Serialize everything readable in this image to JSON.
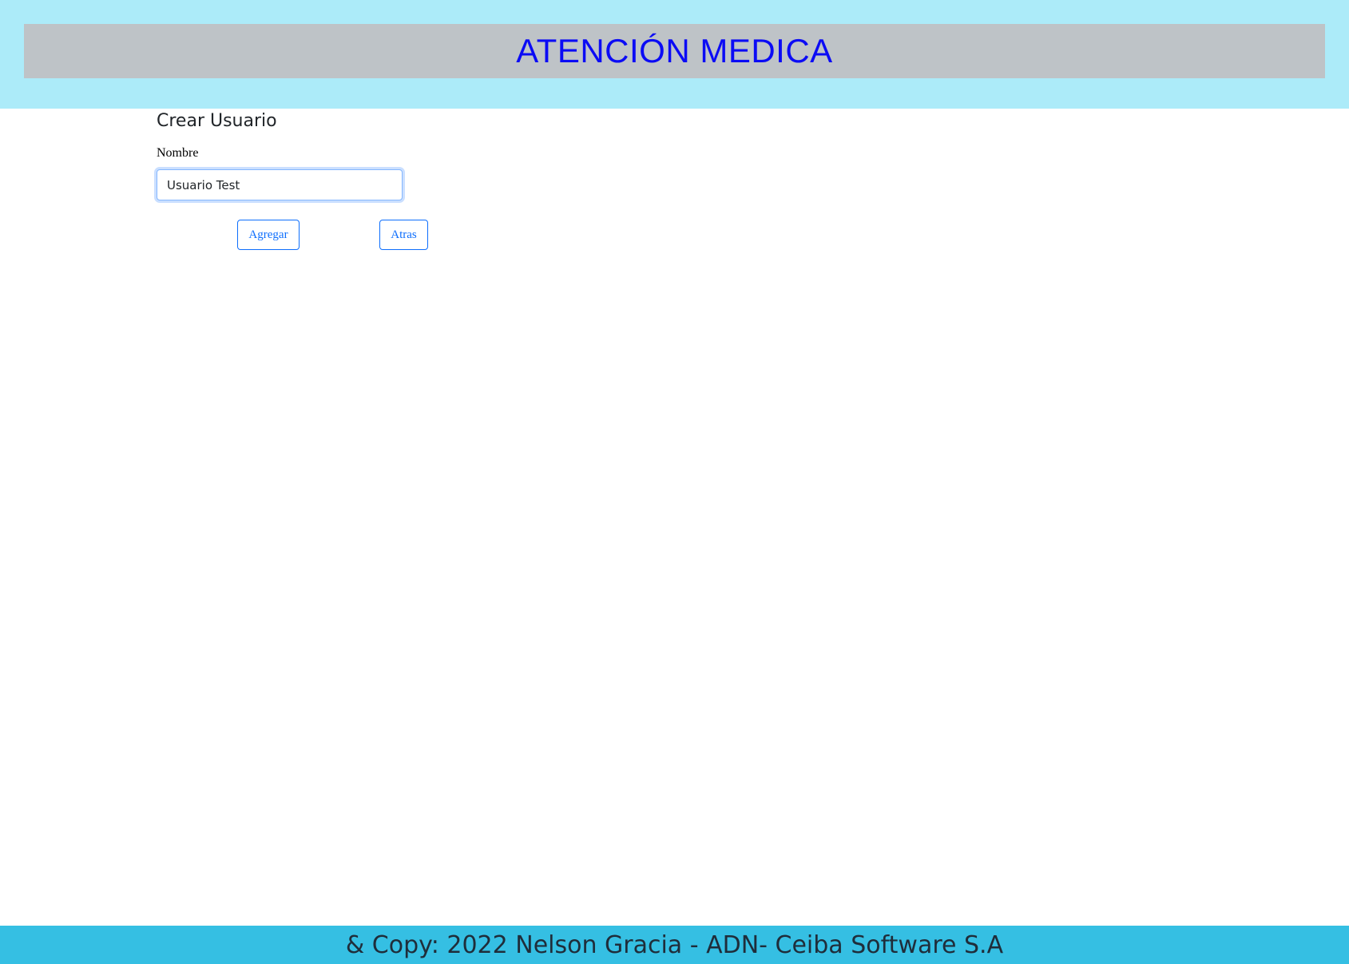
{
  "header": {
    "title": "ATENCIÓN MEDICA",
    "background_color": "#acebf9",
    "title_bar_color": "#bec3c7",
    "title_color": "#0b0bf5"
  },
  "form": {
    "title": "Crear Usuario",
    "nombre_label": "Nombre",
    "nombre_value": "Usuario Test",
    "agregar_label": "Agregar",
    "atras_label": "Atras",
    "button_color": "#0d6efd"
  },
  "footer": {
    "text": "& Copy: 2022 Nelson Gracia - ADN- Ceiba Software S.A",
    "background_color": "#35bfe3"
  }
}
